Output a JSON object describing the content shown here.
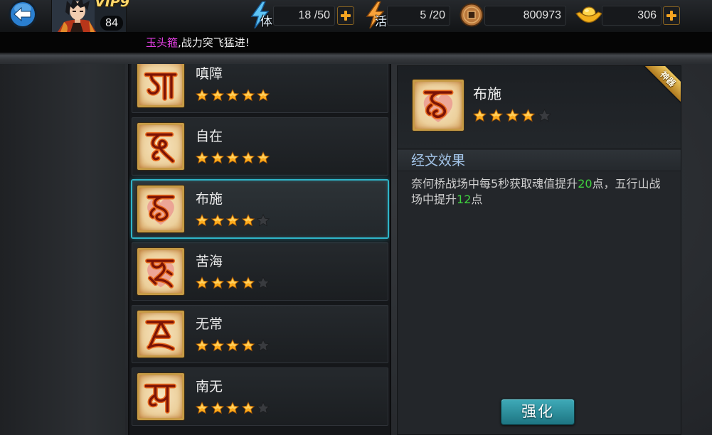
{
  "header": {
    "back_icon": "back-arrow-icon",
    "avatar_icon": "player-avatar-icon",
    "vip": "VIP9",
    "level": "84",
    "stamina": {
      "icon": "stamina-lightning-icon",
      "label": "体",
      "value": "18 /50",
      "add_icon": "plus-icon"
    },
    "vitality": {
      "icon": "vitality-lightning-icon",
      "label": "活",
      "value": "5 /20"
    },
    "copper": {
      "icon": "copper-coin-icon",
      "value": "800973"
    },
    "ingot": {
      "icon": "gold-ingot-icon",
      "value": "306",
      "add_icon": "plus-icon"
    }
  },
  "marquee": {
    "item": "玉头箍",
    "message": ",战力突飞猛进!"
  },
  "rating_max": 5,
  "list": {
    "selected_index": 2,
    "items": [
      {
        "name": "嗔障",
        "stars": 5,
        "icon": "siddham-glyph-icon"
      },
      {
        "name": "自在",
        "stars": 5,
        "icon": "siddham-glyph-icon"
      },
      {
        "name": "布施",
        "stars": 4,
        "icon": "siddham-glyph-icon"
      },
      {
        "name": "苦海",
        "stars": 4,
        "icon": "siddham-glyph-icon"
      },
      {
        "name": "无常",
        "stars": 4,
        "icon": "siddham-glyph-icon"
      },
      {
        "name": "南无",
        "stars": 4,
        "icon": "siddham-glyph-icon"
      }
    ]
  },
  "detail": {
    "icon": "siddham-glyph-icon",
    "name": "布施",
    "stars": 4,
    "badge": "神器",
    "section_title": "经文效果",
    "effect": [
      {
        "text": "奈何桥战场中每5秒获取魂值提升",
        "highlight": false
      },
      {
        "text": "20",
        "highlight": true
      },
      {
        "text": "点，五行山战场中提升",
        "highlight": false
      },
      {
        "text": "12",
        "highlight": true
      },
      {
        "text": "点",
        "highlight": false
      }
    ],
    "upgrade_button": "强化"
  },
  "colors": {
    "marquee_item": "#e03ee0",
    "effect_highlight": "#3fd13f",
    "section_title": "#a4c6ea",
    "selected_border": "#2fb5c9",
    "star_filled": "#ffac1c",
    "star_empty": "#393b3f"
  }
}
